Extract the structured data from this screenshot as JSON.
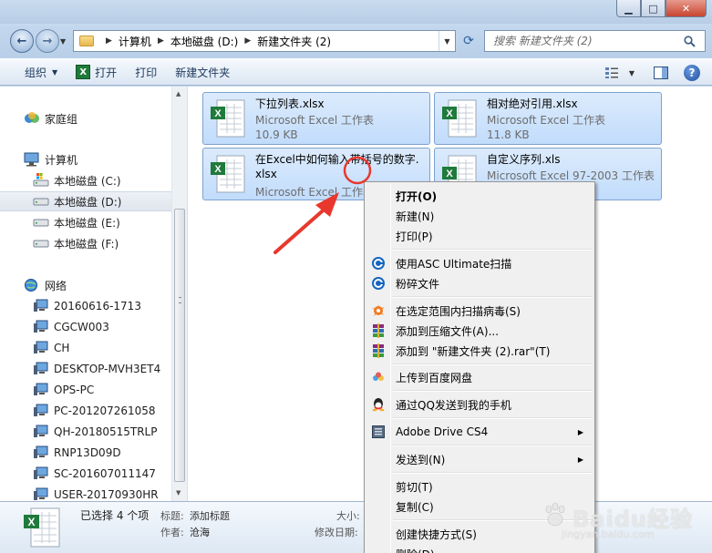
{
  "address_bar": {
    "crumbs": [
      "计算机",
      "本地磁盘 (D:)",
      "新建文件夹 (2)"
    ],
    "search_placeholder": "搜索 新建文件夹 (2)"
  },
  "toolbar": {
    "organize": "组织",
    "open": "打开",
    "print": "打印",
    "new_folder": "新建文件夹"
  },
  "sidebar": {
    "homegroup": "家庭组",
    "computer": "计算机",
    "drives": [
      "本地磁盘 (C:)",
      "本地磁盘 (D:)",
      "本地磁盘 (E:)",
      "本地磁盘 (F:)"
    ],
    "selected_drive": "本地磁盘 (D:)",
    "network": "网络",
    "network_items": [
      "20160616-1713",
      "CGCW003",
      "CH",
      "DESKTOP-MVH3ET4",
      "OPS-PC",
      "PC-201207261058",
      "QH-20180515TRLP",
      "RNP13D09D",
      "SC-201607011147",
      "USER-20170930HR"
    ]
  },
  "files": [
    {
      "name": "下拉列表.xlsx",
      "type": "Microsoft Excel 工作表",
      "size": "10.9 KB"
    },
    {
      "name": "相对绝对引用.xlsx",
      "type": "Microsoft Excel 工作表",
      "size": "11.8 KB"
    },
    {
      "name_line1": "在Excel中如何输入带括号的数字.",
      "name_line2": "xlsx",
      "type": "Microsoft Excel 工作表"
    },
    {
      "name": "自定义序列.xls",
      "type": "Microsoft Excel 97-2003 工作表"
    }
  ],
  "context_menu": {
    "items": [
      "打开(O)",
      "新建(N)",
      "打印(P)",
      "使用ASC Ultimate扫描",
      "粉碎文件",
      "在选定范围内扫描病毒(S)",
      "添加到压缩文件(A)...",
      "添加到 \"新建文件夹 (2).rar\"(T)",
      "上传到百度网盘",
      "通过QQ发送到我的手机",
      "Adobe Drive CS4",
      "发送到(N)",
      "剪切(T)",
      "复制(C)",
      "创建快捷方式(S)",
      "删除(D)"
    ]
  },
  "details": {
    "selected": "已选择 4 个项",
    "title_label": "标题:",
    "title_value": "添加标题",
    "author_label": "作者:",
    "author_value": "沧海",
    "size_label": "大小:",
    "modified_label": "修改日期:"
  },
  "watermark": {
    "brand": "Baidu经验",
    "url": "jingyan.baidu.com"
  },
  "colors": {
    "annotation": "#e8382d",
    "selection_tile": "#cde2fb",
    "menu_bg": "#f0f0f0"
  }
}
